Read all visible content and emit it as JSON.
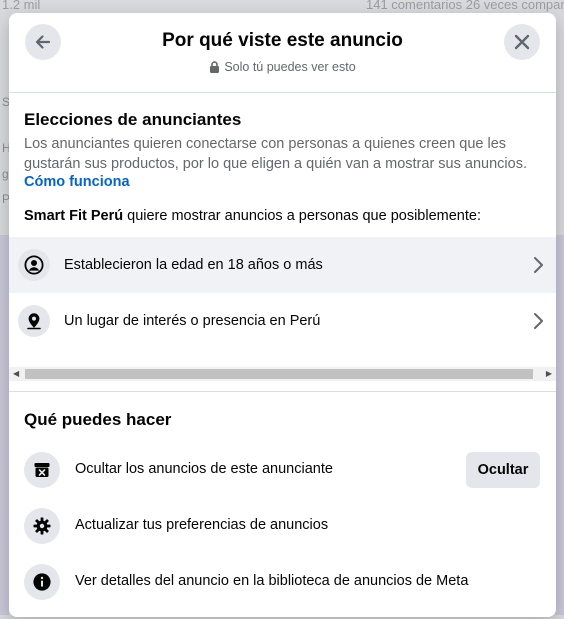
{
  "background": {
    "top_left_text": "1.2 mil",
    "top_right_text": "141 comentarios   26 veces compartido",
    "side_chars": [
      "S",
      "H",
      "gi",
      "P"
    ]
  },
  "header": {
    "title": "Por qué viste este anuncio",
    "privacy_text": "Solo tú puedes ver esto"
  },
  "advertiser_choices": {
    "title": "Elecciones de anunciantes",
    "description": "Los anunciantes quieren conectarse con personas a quienes creen que les gustarán sus productos, por lo que eligen a quién van a mostrar sus anuncios.",
    "link": "Cómo funciona",
    "advertiser": "Smart Fit Perú",
    "sentence_rest": " quiere mostrar anuncios a personas que posiblemente:",
    "reasons": [
      {
        "label": "Establecieron la edad en 18 años o más",
        "icon": "person-icon"
      },
      {
        "label": "Un lugar de interés o presencia en Perú",
        "icon": "location-pin-icon"
      }
    ]
  },
  "actions": {
    "title": "Qué puedes hacer",
    "items": [
      {
        "label": "Ocultar los anuncios de este anunciante",
        "icon": "hide-ad-icon",
        "button": "Ocultar"
      },
      {
        "label": "Actualizar tus preferencias de anuncios",
        "icon": "gear-icon"
      },
      {
        "label": "Ver detalles del anuncio en la biblioteca de anuncios de Meta",
        "icon": "info-icon"
      }
    ]
  },
  "colors": {
    "link": "#0064d1",
    "secondary_text": "#65676b",
    "icon_bg": "#e4e6eb",
    "highlight_row": "#f0f2f5"
  }
}
